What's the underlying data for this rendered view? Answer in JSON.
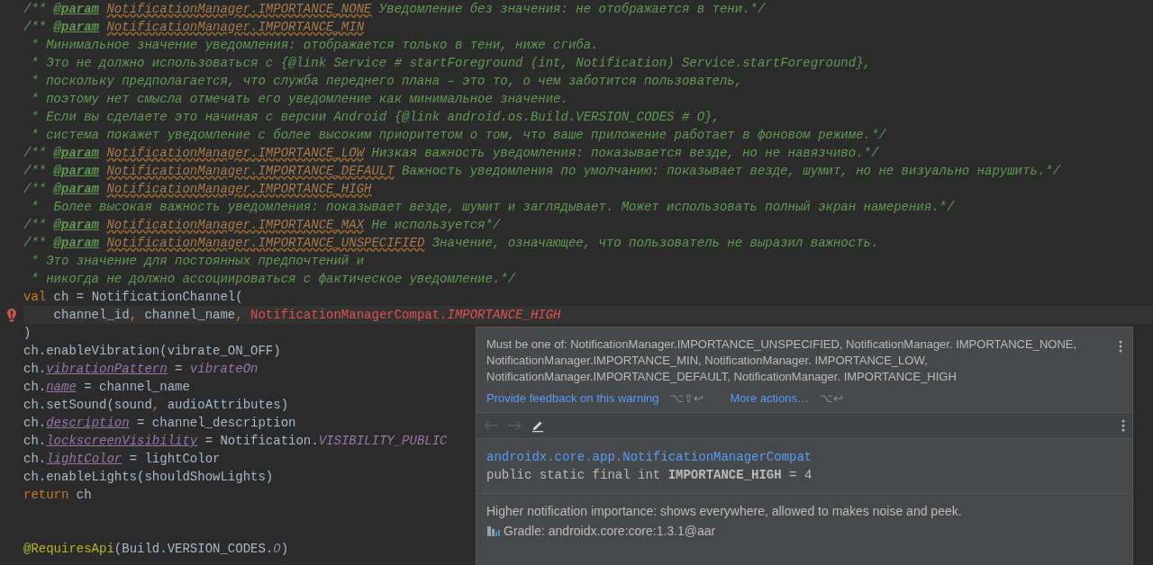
{
  "editor": {
    "lines": [
      {
        "kind": "code",
        "tokens": [
          {
            "kind": "comment",
            "text": "/** "
          },
          {
            "kind": "tag",
            "text": "@param"
          },
          {
            "kind": "ref",
            "text": "NotificationManager.IMPORTANCE_NONE"
          },
          {
            "kind": "comment",
            "text": " Уведомление без значения: не отображается в тени.*/"
          }
        ]
      },
      {
        "kind": "code",
        "tokens": [
          {
            "kind": "comment",
            "text": "/** "
          },
          {
            "kind": "tag",
            "text": "@param"
          },
          {
            "kind": "ref",
            "text": "NotificationManager.IMPORTANCE_MIN"
          }
        ]
      },
      {
        "kind": "code",
        "tokens": [
          {
            "kind": "comment",
            "text": " * Минимальное значение уведомления: отображается только в тени, ниже сгиба."
          }
        ]
      },
      {
        "kind": "code",
        "tokens": [
          {
            "kind": "comment",
            "text": " * Это не должно использоваться с {@link Service # startForeground (int, Notification) Service.startForeground},"
          }
        ]
      },
      {
        "kind": "code",
        "tokens": [
          {
            "kind": "comment",
            "text": " * поскольку предполагается, что служба переднего плана – это то, о чем заботится пользователь,"
          }
        ]
      },
      {
        "kind": "code",
        "tokens": [
          {
            "kind": "comment",
            "text": " * поэтому нет смысла отмечать его уведомление как минимальное значение."
          }
        ]
      },
      {
        "kind": "code",
        "tokens": [
          {
            "kind": "comment",
            "text": " * Если вы сделаете это начиная с версии Android {@link android.os.Build.VERSION_CODES # O},"
          }
        ]
      },
      {
        "kind": "code",
        "tokens": [
          {
            "kind": "comment",
            "text": " * система покажет уведомление с более высоким приоритетом о том, что ваше приложение работает в фоновом режиме.*/"
          }
        ]
      },
      {
        "kind": "code",
        "tokens": [
          {
            "kind": "comment",
            "text": "/** "
          },
          {
            "kind": "tag",
            "text": "@param"
          },
          {
            "kind": "ref",
            "text": "NotificationManager.IMPORTANCE_LOW"
          },
          {
            "kind": "comment",
            "text": " Низкая важность уведомления: показывается везде, но не навязчиво.*/"
          }
        ]
      },
      {
        "kind": "code",
        "tokens": [
          {
            "kind": "comment",
            "text": "/** "
          },
          {
            "kind": "tag",
            "text": "@param"
          },
          {
            "kind": "ref",
            "text": "NotificationManager.IMPORTANCE_DEFAULT"
          },
          {
            "kind": "comment",
            "text": " Важность уведомления по умолчанию: показывает везде, шумит, но не визуально нарушить.*/"
          }
        ]
      },
      {
        "kind": "code",
        "tokens": [
          {
            "kind": "comment",
            "text": "/** "
          },
          {
            "kind": "tag",
            "text": "@param"
          },
          {
            "kind": "ref",
            "text": "NotificationManager.IMPORTANCE_HIGH"
          }
        ]
      },
      {
        "kind": "code",
        "tokens": [
          {
            "kind": "comment",
            "text": " *  Более высокая важность уведомления: показывает везде, шумит и заглядывает. Может использовать полный экран намерения.*/"
          }
        ]
      },
      {
        "kind": "code",
        "tokens": [
          {
            "kind": "comment",
            "text": "/** "
          },
          {
            "kind": "tag",
            "text": "@param"
          },
          {
            "kind": "ref",
            "text": "NotificationManager.IMPORTANCE_MAX"
          },
          {
            "kind": "comment",
            "text": " Не используется*/"
          }
        ]
      },
      {
        "kind": "code",
        "tokens": [
          {
            "kind": "comment",
            "text": "/** "
          },
          {
            "kind": "tag",
            "text": "@param"
          },
          {
            "kind": "ref",
            "text": "NotificationManager.IMPORTANCE_UNSPECIFIED"
          },
          {
            "kind": "comment",
            "text": " Значение, означающее, что пользователь не выразил важность."
          }
        ]
      },
      {
        "kind": "code",
        "tokens": [
          {
            "kind": "comment",
            "text": " * Это значение для постоянных предпочтений и"
          }
        ]
      },
      {
        "kind": "code",
        "tokens": [
          {
            "kind": "comment",
            "text": " * никогда не должно ассоциироваться с фактическое уведомление.*/"
          }
        ]
      },
      {
        "kind": "code",
        "tokens": [
          {
            "kind": "keyword",
            "text": "val"
          },
          {
            "kind": "plain",
            "text": " ch = NotificationChannel("
          }
        ]
      },
      {
        "kind": "error",
        "tokens": [
          {
            "kind": "plain",
            "text": "    channel_id"
          },
          {
            "kind": "punct",
            "text": ","
          },
          {
            "kind": "plain",
            "text": " channel_name"
          },
          {
            "kind": "punct",
            "text": ","
          },
          {
            "kind": "error",
            "text": " NotificationManagerCompat."
          },
          {
            "kind": "error-static",
            "text": "IMPORTANCE_HIGH"
          }
        ]
      },
      {
        "kind": "code",
        "tokens": [
          {
            "kind": "plain",
            "text": ")"
          }
        ]
      },
      {
        "kind": "code",
        "tokens": [
          {
            "kind": "plain",
            "text": "ch.enableVibration(vibrate_ON_OFF)"
          }
        ]
      },
      {
        "kind": "code",
        "tokens": [
          {
            "kind": "plain",
            "text": "ch."
          },
          {
            "kind": "field",
            "text": "vibrationPattern"
          },
          {
            "kind": "plain",
            "text": " = "
          },
          {
            "kind": "static",
            "text": "vibrateOn"
          }
        ]
      },
      {
        "kind": "code",
        "tokens": [
          {
            "kind": "plain",
            "text": "ch."
          },
          {
            "kind": "field",
            "text": "name"
          },
          {
            "kind": "plain",
            "text": " = channel_name"
          }
        ]
      },
      {
        "kind": "code",
        "tokens": [
          {
            "kind": "plain",
            "text": "ch.setSound(sound"
          },
          {
            "kind": "punct",
            "text": ","
          },
          {
            "kind": "plain",
            "text": " audioAttributes)"
          }
        ]
      },
      {
        "kind": "code",
        "tokens": [
          {
            "kind": "plain",
            "text": "ch."
          },
          {
            "kind": "field",
            "text": "description"
          },
          {
            "kind": "plain",
            "text": " = channel_description"
          }
        ]
      },
      {
        "kind": "code",
        "tokens": [
          {
            "kind": "plain",
            "text": "ch."
          },
          {
            "kind": "field",
            "text": "lockscreenVisibility"
          },
          {
            "kind": "plain",
            "text": " = Notification."
          },
          {
            "kind": "static",
            "text": "VISIBILITY_PUBLIC"
          }
        ]
      },
      {
        "kind": "code",
        "tokens": [
          {
            "kind": "plain",
            "text": "ch."
          },
          {
            "kind": "field",
            "text": "lightColor"
          },
          {
            "kind": "plain",
            "text": " = lightColor"
          }
        ]
      },
      {
        "kind": "code",
        "tokens": [
          {
            "kind": "plain",
            "text": "ch.enableLights(shouldShowLights)"
          }
        ]
      },
      {
        "kind": "code",
        "tokens": [
          {
            "kind": "keyword",
            "text": "return"
          },
          {
            "kind": "plain",
            "text": " ch"
          }
        ]
      },
      {
        "kind": "blank"
      },
      {
        "kind": "blank"
      },
      {
        "kind": "code",
        "tokens": [
          {
            "kind": "annotation",
            "text": "@RequiresApi"
          },
          {
            "kind": "plain",
            "text": "(Build.VERSION_CODES."
          },
          {
            "kind": "static",
            "text": "O"
          },
          {
            "kind": "plain",
            "text": ")"
          }
        ]
      }
    ]
  },
  "popup": {
    "message": "Must be one of: NotificationManager.IMPORTANCE_UNSPECIFIED, NotificationManager. IMPORTANCE_NONE, NotificationManager.IMPORTANCE_MIN, NotificationManager. IMPORTANCE_LOW, NotificationManager.IMPORTANCE_DEFAULT, NotificationManager. IMPORTANCE_HIGH",
    "actions": [
      {
        "label": "Provide feedback on this warning",
        "shortcut": "⌥⇧↩"
      },
      {
        "label": "More actions…",
        "shortcut": "⌥↩"
      }
    ],
    "nav": {
      "back_disabled": true,
      "forward_disabled": true
    },
    "doc": {
      "class_link": "androidx.core.app.NotificationManagerCompat",
      "signature": "public static final int **IMPORTANCE_HIGH** = 4",
      "description": "Higher notification importance: shows everywhere, allowed to makes noise and peek.",
      "source": "Gradle: androidx.core:core:1.3.1@aar"
    }
  }
}
